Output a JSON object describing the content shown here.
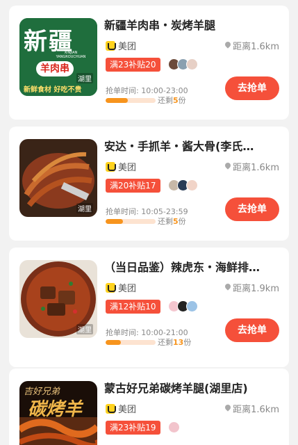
{
  "colors": {
    "accent": "#f5503a",
    "progress": "#f7941d",
    "progress_track": "#fde3d0"
  },
  "cards": [
    {
      "title": "新疆羊肉串・炭烤羊腿",
      "platform": "美团",
      "distance": "距离1.6km",
      "subsidy": "满23补贴20",
      "grab_time": "抢单时间: 10:00-23:00",
      "remain_prefix": "还剩",
      "remain_count": "5",
      "remain_suffix": "份",
      "button": "去抢单",
      "thumb_tag": "湖里",
      "progress": 0.45,
      "thumb_text_main": "新疆",
      "thumb_text_pinyin": "XINJIAN YANGROUCHUAN",
      "thumb_text_sub": "羊肉串",
      "thumb_text_slogan": "新鲜食材 好吃不贵"
    },
    {
      "title": "安达・手抓羊・酱大骨(李氏…",
      "platform": "美团",
      "distance": "距离1.6km",
      "subsidy": "满20补贴17",
      "grab_time": "抢单时间: 10:05-23:59",
      "remain_prefix": "还剩",
      "remain_count": "5",
      "remain_suffix": "份",
      "button": "去抢单",
      "thumb_tag": "湖里",
      "progress": 0.35
    },
    {
      "title": "（当日品鉴）辣虎东・海鲜排…",
      "platform": "美团",
      "distance": "距离1.9km",
      "subsidy": "满12补贴10",
      "grab_time": "抢单时间: 10:00-21:00",
      "remain_prefix": "还剩",
      "remain_count": "13",
      "remain_suffix": "份",
      "button": "去抢单",
      "thumb_tag": "湖里",
      "progress": 0.3
    },
    {
      "title": "蒙古好兄弟碳烤羊腿(湖里店)",
      "platform": "美团",
      "distance": "距离1.6km",
      "subsidy": "满23补贴19",
      "thumb_text_top": "吉好兄弟",
      "thumb_text_main": "碳烤羊"
    }
  ]
}
